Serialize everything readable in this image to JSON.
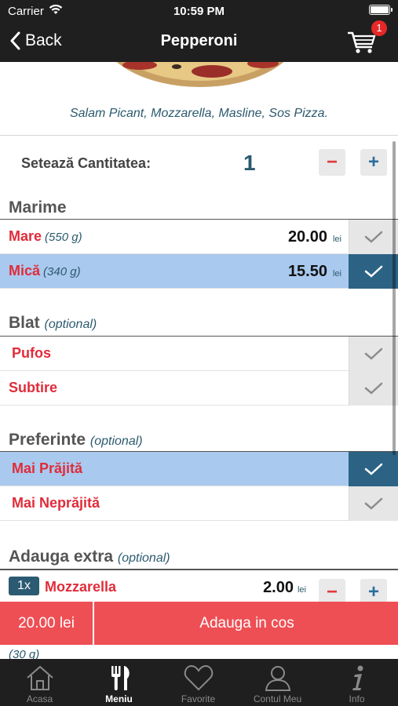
{
  "status_bar": {
    "carrier": "Carrier",
    "time": "10:59 PM"
  },
  "nav": {
    "back_label": "Back",
    "title": "Pepperoni",
    "cart_count": "1"
  },
  "product": {
    "description": "Salam Picant, Mozzarella, Masline, Sos Pizza."
  },
  "quantity": {
    "label": "Setează Cantitatea:",
    "value": "1",
    "minus": "−",
    "plus": "+"
  },
  "sections": {
    "marime": {
      "title": "Marime",
      "rows": [
        {
          "name": "Mare",
          "weight": "(550 g)",
          "price": "20.00",
          "unit": "lei",
          "selected": false
        },
        {
          "name": "Mică",
          "weight": "(340 g)",
          "price": "15.50",
          "unit": "lei",
          "selected": true
        }
      ]
    },
    "blat": {
      "title": "Blat",
      "optional": "(optional)",
      "rows": [
        {
          "name": "Pufos",
          "selected": false
        },
        {
          "name": "Subtire",
          "selected": false
        }
      ]
    },
    "preferinte": {
      "title": "Preferinte",
      "optional": "(optional)",
      "rows": [
        {
          "name": "Mai Prăjită",
          "selected": true
        },
        {
          "name": "Mai Neprăjită",
          "selected": false
        }
      ]
    },
    "extra": {
      "title": "Adauga extra",
      "optional": "(optional)",
      "rows": [
        {
          "qty": "1x",
          "name": "Mozzarella",
          "price": "2.00",
          "unit": "lei",
          "minus": "−",
          "plus": "+"
        }
      ],
      "next_weight": "(30 g)"
    }
  },
  "add_bar": {
    "total": "20.00 lei",
    "action": "Adauga in cos"
  },
  "tabs": [
    {
      "label": "Acasa",
      "icon": "home-icon",
      "active": false
    },
    {
      "label": "Meniu",
      "icon": "fork-knife-icon",
      "active": true
    },
    {
      "label": "Favorite",
      "icon": "heart-icon",
      "active": false
    },
    {
      "label": "Contul Meu",
      "icon": "user-icon",
      "active": false
    },
    {
      "label": "Info",
      "icon": "info-icon",
      "active": false
    }
  ],
  "colors": {
    "accent_red": "#e02c3a",
    "selected_row": "#a9c9ee",
    "check_active": "#2c6385",
    "add_bar": "#ee4f55",
    "bar_dark": "#1f1f1f"
  }
}
